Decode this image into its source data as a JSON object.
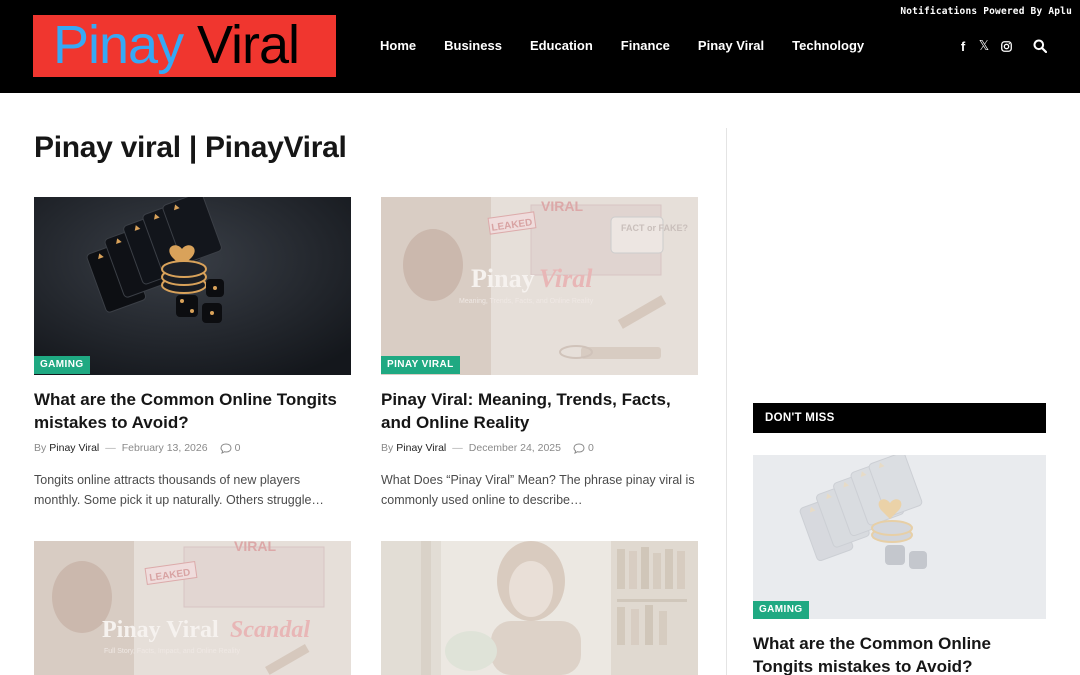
{
  "header": {
    "logo_word1": "Pinay",
    "logo_word2": "Viral",
    "notification": "Notifications Powered By Aplu",
    "nav": [
      "Home",
      "Business",
      "Education",
      "Finance",
      "Pinay Viral",
      "Technology"
    ],
    "social_icons": [
      "facebook-icon",
      "x-icon",
      "instagram-icon"
    ],
    "search_icon": "search-icon"
  },
  "page_title": "Pinay viral | PinayViral",
  "posts": [
    {
      "category": "GAMING",
      "title": "What are the Common Online Tongits mistakes to Avoid?",
      "by": "By",
      "author": "Pinay Viral",
      "date": "February 13, 2026",
      "comments": "0",
      "excerpt": "Tongits online attracts thousands of new players monthly. Some pick it up naturally. Others struggle…"
    },
    {
      "category": "PINAY VIRAL",
      "title": "Pinay Viral: Meaning, Trends, Facts, and Online Reality",
      "by": "By",
      "author": "Pinay Viral",
      "date": "December 24, 2025",
      "comments": "0",
      "excerpt": "What Does “Pinay Viral” Mean? The phrase pinay viral is commonly used online to describe…",
      "image_text": {
        "leaked": "LEAKED",
        "viral": "VIRAL",
        "fact_or_fake": "FACT or FAKE?",
        "brand1": "Pinay",
        "brand2": "Viral",
        "subtitle": "Meaning, Trends, Facts, and Online Reality"
      }
    },
    {
      "image_text": {
        "leaked": "LEAKED",
        "viral": "VIRAL",
        "brand1": "Pinay Viral",
        "brand2": "Scandal",
        "subtitle": "Full Story, Facts, Impact, and Online Reality"
      }
    },
    {}
  ],
  "sidebar": {
    "dont_miss": "DON'T MISS",
    "category": "GAMING",
    "title": "What are the Common Online Tongits mistakes to Avoid?"
  },
  "colors": {
    "header_bg": "#000000",
    "logo_bg": "#f0362f",
    "logo_blue": "#36a9f5",
    "badge": "#1fa982"
  }
}
